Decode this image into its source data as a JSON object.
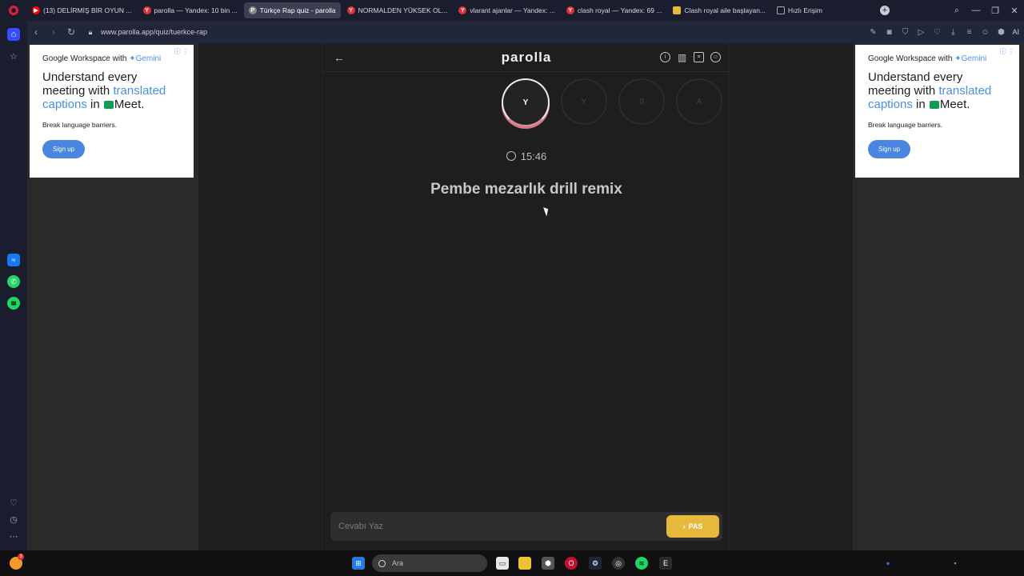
{
  "browser": {
    "tabs": [
      {
        "label": "(13) DELİRMİŞ BİR OYUN ...",
        "color": "#ff0000"
      },
      {
        "label": "parolla — Yandex: 10 bin ...",
        "color": "#7a3cff"
      },
      {
        "label": "Türkçe Rap quiz - parolla",
        "color": "#888888",
        "active": true
      },
      {
        "label": "NORMALDEN YÜKSEK OL...",
        "color": "#e0303a"
      },
      {
        "label": "vlarant ajanlar — Yandex: ...",
        "color": "#e0303a"
      },
      {
        "label": "clash royal — Yandex: 69 ...",
        "color": "#e0303a"
      },
      {
        "label": "Clash royal aile başlayan...",
        "color": "#e6b93c"
      },
      {
        "label": "Hızlı Erişim",
        "color": "#444444"
      }
    ],
    "url": "www.parolla.app/quiz/tuerkce-rap",
    "ai_label": "AI"
  },
  "ads": {
    "brand": "Google Workspace with",
    "brand_highlight": "Gemini",
    "headline_part1": "Understand every meeting with",
    "headline_highlight": "translated captions",
    "headline_part2": "in",
    "headline_meet": "Meet.",
    "subtext": "Break language barriers.",
    "cta": "Sign up"
  },
  "app": {
    "logo": "parolla",
    "letters": [
      "Y",
      "Y",
      "0",
      "A"
    ],
    "current_letter_index": 0,
    "timer": "15:46",
    "question": "Pembe mezarlık drill remix",
    "answer_placeholder": "Cevabı Yaz",
    "pass_label": "PAS"
  },
  "taskbar": {
    "search_placeholder": "Ara",
    "notification_count": "3"
  },
  "colors": {
    "accent": "#e6b93c",
    "ad_blue": "#4a85e0"
  }
}
